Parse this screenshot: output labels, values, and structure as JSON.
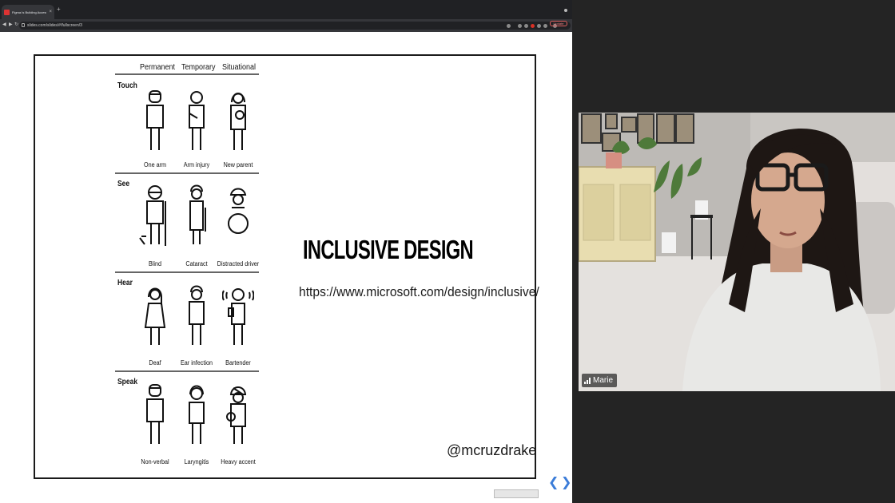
{
  "browser": {
    "tab_title": "Figma Is Building Accessibility...",
    "url": "slides.com/slides/#/fullscreen/3",
    "update_label": "Update"
  },
  "slide": {
    "columns": [
      "Permanent",
      "Temporary",
      "Situational"
    ],
    "rows": [
      {
        "label": "Touch",
        "captions": [
          "One arm",
          "Arm injury",
          "New parent"
        ]
      },
      {
        "label": "See",
        "captions": [
          "Blind",
          "Cataract",
          "Distracted driver"
        ]
      },
      {
        "label": "Hear",
        "captions": [
          "Deaf",
          "Ear infection",
          "Bartender"
        ]
      },
      {
        "label": "Speak",
        "captions": [
          "Non-verbal",
          "Laryngitis",
          "Heavy accent"
        ]
      }
    ],
    "headline": "INCLUSIVE DESIGN",
    "link": "https://www.microsoft.com/design/inclusive/",
    "handle": "@mcruzdrake",
    "prev_glyph": "❮",
    "next_glyph": "❯"
  },
  "video": {
    "participant_name": "Marie"
  },
  "colors": {
    "page_bg": "#242424",
    "slide_accent": "#3b7cd8",
    "browser_chrome": "#35363a"
  }
}
